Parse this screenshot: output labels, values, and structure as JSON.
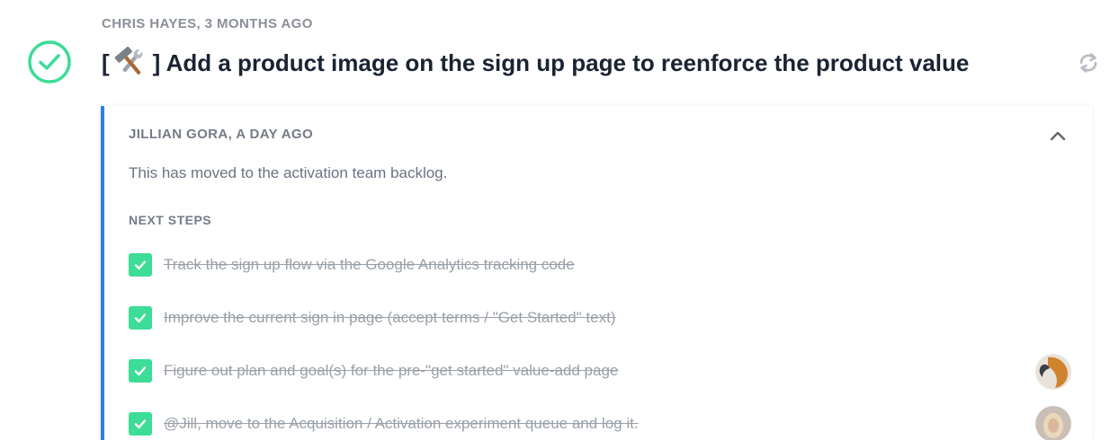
{
  "item": {
    "author_meta": "CHRIS HAYES, 3 MONTHS AGO",
    "title_prefix": "[",
    "title_suffix": "] Add a product image on the sign up page to reenforce the product value",
    "status_icon": "check-circle-icon",
    "emoji_icon": "hammer-and-wrench-icon",
    "action_icon": "refresh-icon",
    "accent_color": "#3ddc97"
  },
  "comment": {
    "author_meta": "JILLIAN GORA, A DAY AGO",
    "body": "This has moved to the activation team backlog.",
    "section_label": "NEXT STEPS",
    "border_color": "#2f80ed",
    "collapse_icon": "chevron-up-icon",
    "steps": [
      {
        "text": "Track the sign up flow via the Google Analytics tracking code",
        "checked": true
      },
      {
        "text": "Improve the current sign in page (accept terms / \"Get Started\" text)",
        "checked": true
      },
      {
        "text": "Figure out plan and goal(s) for the pre-\"get started\" value-add page",
        "checked": true
      },
      {
        "text": "@Jill, move to the Acquisition / Activation experiment queue and log it.",
        "checked": true
      }
    ]
  }
}
